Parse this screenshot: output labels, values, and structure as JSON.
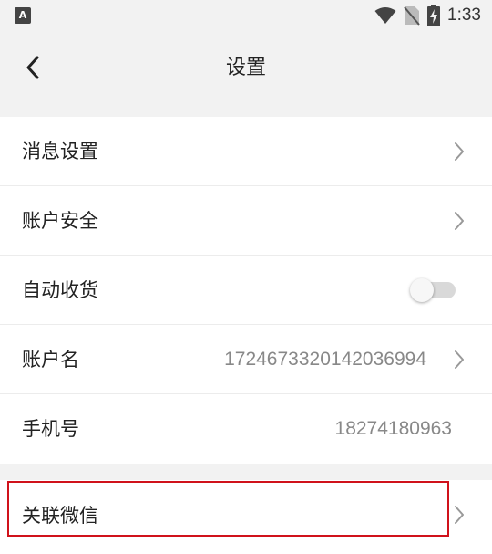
{
  "status_bar": {
    "app_icon_letter": "A",
    "time": "1:33"
  },
  "header": {
    "title": "设置"
  },
  "settings": {
    "message_settings": {
      "label": "消息设置"
    },
    "account_security": {
      "label": "账户安全"
    },
    "auto_receive": {
      "label": "自动收货",
      "enabled": false
    },
    "account_name": {
      "label": "账户名",
      "value": "1724673320142036994"
    },
    "phone": {
      "label": "手机号",
      "value": "18274180963"
    },
    "link_wechat": {
      "label": "关联微信"
    }
  },
  "colors": {
    "background": "#f2f2f2",
    "card": "#ffffff",
    "highlight": "#d0121b",
    "value_text": "#888888"
  }
}
